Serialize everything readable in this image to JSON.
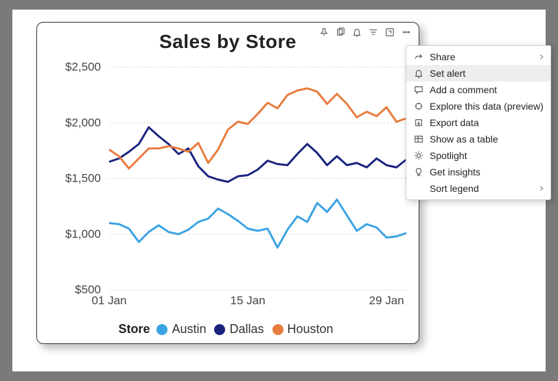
{
  "title": "Sales by Store",
  "toolbar_icons": [
    "pin",
    "copy",
    "bell",
    "filter",
    "focus",
    "more"
  ],
  "y_ticks": [
    "$2,500",
    "$2,000",
    "$1,500",
    "$1,000",
    "$500"
  ],
  "x_ticks": [
    "01 Jan",
    "15 Jan",
    "29 Jan"
  ],
  "legend_title": "Store",
  "legend": [
    {
      "name": "Austin",
      "color": "#3aa3e3"
    },
    {
      "name": "Dallas",
      "color": "#1a237e"
    },
    {
      "name": "Houston",
      "color": "#e87b3e"
    }
  ],
  "menu": {
    "items": [
      {
        "label": "Share",
        "icon": "share",
        "chevron": true
      },
      {
        "label": "Set alert",
        "icon": "bell",
        "highlight": true
      },
      {
        "label": "Add a comment",
        "icon": "comment"
      },
      {
        "label": "Explore this data (preview)",
        "icon": "explore"
      },
      {
        "label": "Export data",
        "icon": "export"
      },
      {
        "label": "Show as a table",
        "icon": "table"
      },
      {
        "label": "Spotlight",
        "icon": "spotlight"
      },
      {
        "label": "Get insights",
        "icon": "bulb"
      },
      {
        "label": "Sort legend",
        "icon": "",
        "chevron": true
      }
    ]
  },
  "chart_data": {
    "type": "line",
    "title": "Sales by Store",
    "xlabel": "",
    "ylabel": "",
    "ylim": [
      500,
      2500
    ],
    "x": [
      1,
      2,
      3,
      4,
      5,
      6,
      7,
      8,
      9,
      10,
      11,
      12,
      13,
      14,
      15,
      16,
      17,
      18,
      19,
      20,
      21,
      22,
      23,
      24,
      25,
      26,
      27,
      28,
      29,
      30,
      31
    ],
    "categories_display": [
      "01 Jan",
      "15 Jan",
      "29 Jan"
    ],
    "series": [
      {
        "name": "Austin",
        "color": "#3aa3e3",
        "values": [
          1100,
          1090,
          1050,
          930,
          1020,
          1080,
          1020,
          1000,
          1040,
          1110,
          1140,
          1230,
          1180,
          1120,
          1050,
          1030,
          1050,
          880,
          1040,
          1160,
          1110,
          1280,
          1200,
          1310,
          1170,
          1030,
          1090,
          1060,
          970,
          980,
          1010
        ]
      },
      {
        "name": "Dallas",
        "color": "#1a237e",
        "values": [
          1650,
          1680,
          1740,
          1810,
          1960,
          1880,
          1810,
          1720,
          1770,
          1610,
          1520,
          1490,
          1470,
          1520,
          1530,
          1580,
          1660,
          1630,
          1620,
          1720,
          1810,
          1730,
          1620,
          1700,
          1620,
          1640,
          1600,
          1680,
          1620,
          1600,
          1670
        ]
      },
      {
        "name": "Houston",
        "color": "#e87b3e",
        "values": [
          1760,
          1700,
          1590,
          1680,
          1770,
          1770,
          1790,
          1770,
          1740,
          1820,
          1640,
          1760,
          1940,
          2010,
          1990,
          2080,
          2180,
          2130,
          2250,
          2290,
          2310,
          2280,
          2170,
          2260,
          2170,
          2050,
          2100,
          2060,
          2140,
          2010,
          2040
        ]
      }
    ]
  }
}
